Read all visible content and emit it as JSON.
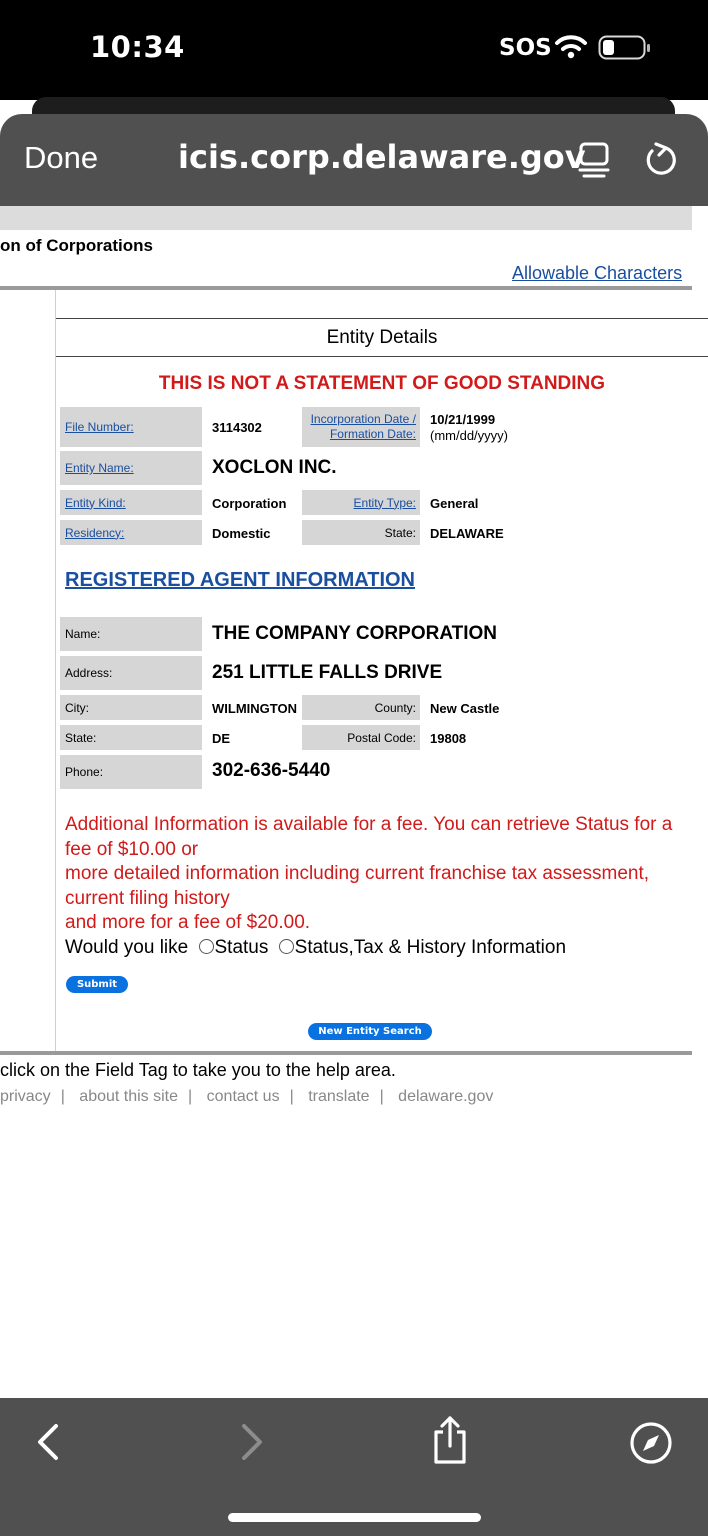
{
  "status_bar": {
    "time": "10:34",
    "sos": "SOS"
  },
  "browser": {
    "done_label": "Done",
    "url": "icis.corp.delaware.gov"
  },
  "page": {
    "division_title": "on of Corporations",
    "allowable_chars_link": "Allowable Characters",
    "entity_details_header": "Entity Details",
    "warning": "THIS IS NOT A STATEMENT OF GOOD STANDING",
    "entity": {
      "file_number_label": "File Number:",
      "file_number": "3114302",
      "inc_date_label_1": "Incorporation Date /",
      "inc_date_label_2": "Formation Date:",
      "inc_date": "10/21/1999",
      "inc_date_format": "(mm/dd/yyyy)",
      "name_label": "Entity Name:",
      "name": "XOCLON INC.",
      "kind_label": "Entity Kind:",
      "kind": "Corporation",
      "type_label": "Entity Type:",
      "type": "General",
      "residency_label": "Residency:",
      "residency": "Domestic",
      "state_label": "State:",
      "state": "DELAWARE"
    },
    "agent": {
      "heading": "REGISTERED AGENT INFORMATION",
      "name_label": "Name:",
      "name": "THE COMPANY CORPORATION",
      "address_label": "Address:",
      "address": "251 LITTLE FALLS DRIVE",
      "city_label": "City:",
      "city": "WILMINGTON",
      "county_label": "County:",
      "county": "New Castle",
      "state_label": "State:",
      "state": "DE",
      "postal_label": "Postal Code:",
      "postal": "19808",
      "phone_label": "Phone:",
      "phone": "302-636-5440"
    },
    "additional_info": {
      "line1": "Additional Information is available for a fee. You can retrieve Status for a fee of $10.00 or",
      "line2": "more detailed information including current franchise tax assessment, current filing history",
      "line3": "and more for a fee of $20.00.",
      "question": "Would you like",
      "option_status": "Status",
      "option_full": "Status,Tax & History Information"
    },
    "submit_label": "Submit",
    "new_search_label": "New Entity Search",
    "help_note": "click on the Field Tag to take you to the help area.",
    "footer_links": [
      "privacy",
      "about this site",
      "contact us",
      "translate",
      "delaware.gov"
    ]
  }
}
